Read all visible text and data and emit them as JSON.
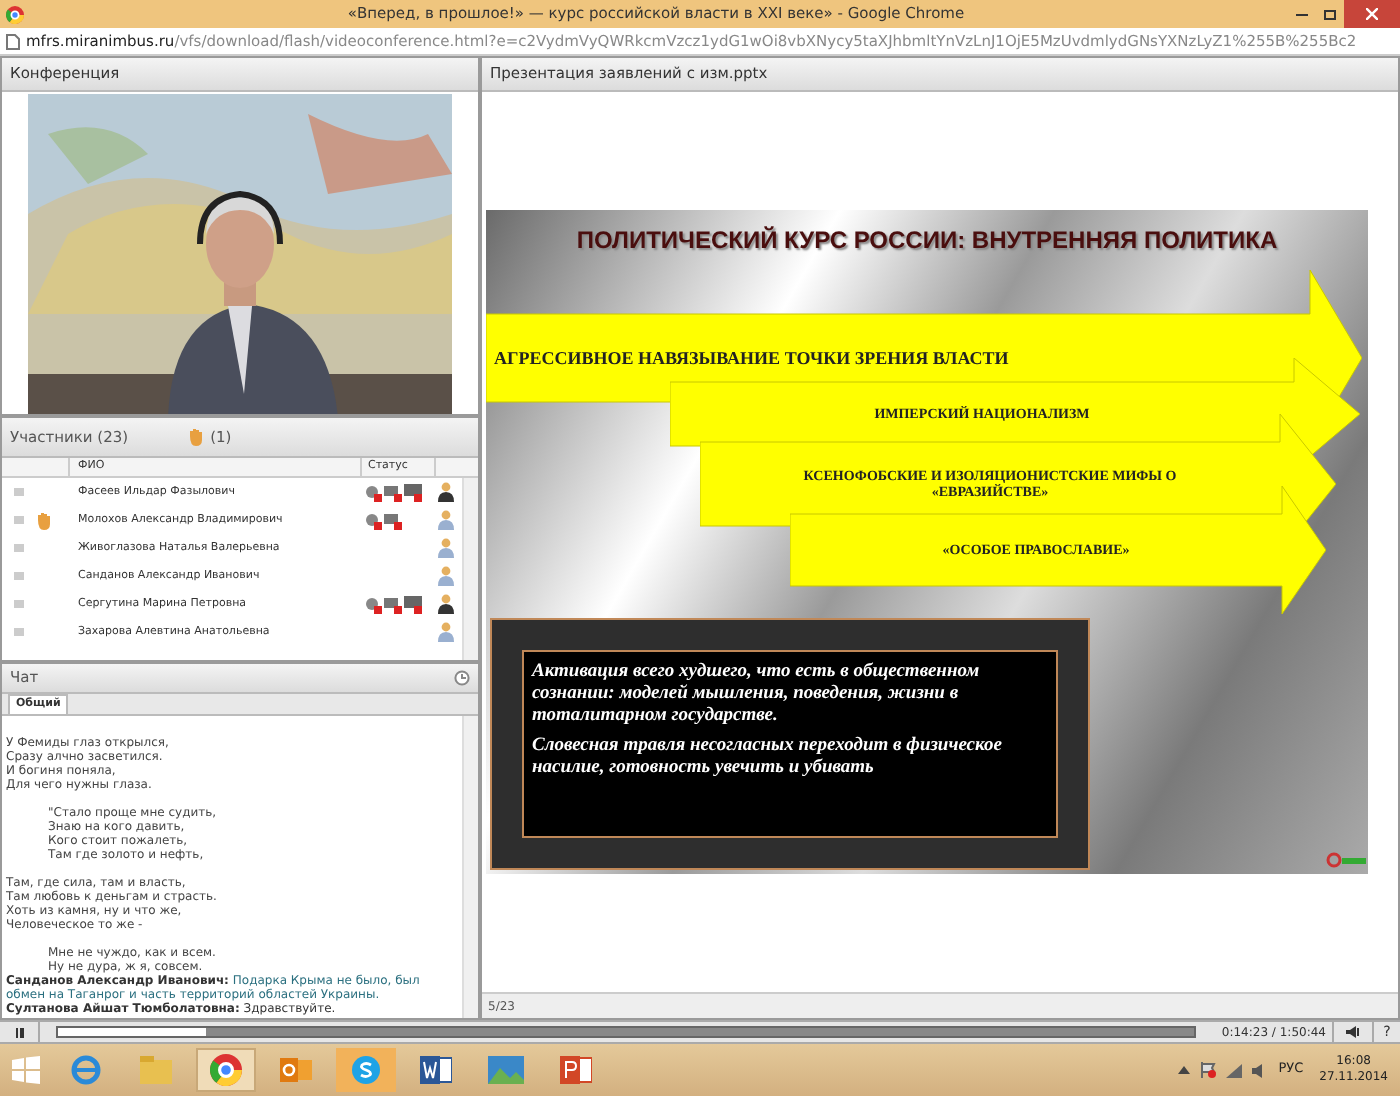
{
  "browser": {
    "title": "«Вперед, в прошлое!» — курс российской власти в XXI веке» - Google Chrome",
    "url_host": "mfrs.miranimbus.ru",
    "url_path": "/vfs/download/flash/videoconference.html?e=c2VydmVyQWRkcmVzcz1ydG1wOi8vbXNycy5taXJhbmltYnVzLnJ1OjE5MzUvdmlydGNsYXNzLyZ1%255B%255Bc2"
  },
  "conference": {
    "title": "Конференция"
  },
  "participants": {
    "title": "Участники (23)",
    "raised_hands": "(1)",
    "columns": [
      "ФИО",
      "Статус"
    ],
    "rows": [
      {
        "name": "Фасеев Ильдар Фазылович",
        "hand_raised": false,
        "mic": true,
        "cam": true,
        "screen": true,
        "active": true
      },
      {
        "name": "Молохов Александр Владимирович",
        "hand_raised": true,
        "mic": true,
        "cam": true,
        "screen": false,
        "active": false
      },
      {
        "name": "Живоглазова Наталья Валерьевна",
        "hand_raised": false,
        "mic": false,
        "cam": false,
        "screen": false,
        "active": false
      },
      {
        "name": "Санданов Александр Иванович",
        "hand_raised": false,
        "mic": false,
        "cam": false,
        "screen": false,
        "active": false
      },
      {
        "name": "Сергутина Марина Петровна",
        "hand_raised": false,
        "mic": true,
        "cam": true,
        "screen": true,
        "active": true
      },
      {
        "name": "Захарова Алевтина Анатольевна",
        "hand_raised": false,
        "mic": false,
        "cam": false,
        "screen": false,
        "active": false
      }
    ]
  },
  "chat": {
    "title": "Чат",
    "tabs": [
      {
        "label": "Общий",
        "selected": true
      }
    ],
    "lines": [
      {
        "kind": "line",
        "text": "У Фемиды глаз открылся,",
        "indent": false
      },
      {
        "kind": "line",
        "text": "Сразу алчно засветился.",
        "indent": false
      },
      {
        "kind": "line",
        "text": "И богиня  поняла,",
        "indent": false
      },
      {
        "kind": "line",
        "text": "Для чего нужны глаза.",
        "indent": false
      },
      {
        "kind": "blank"
      },
      {
        "kind": "line",
        "text": "\"Стало проще мне судить,",
        "indent": true
      },
      {
        "kind": "line",
        "text": "Знаю на  кого  давить,",
        "indent": true
      },
      {
        "kind": "line",
        "text": "Кого стоит пожалеть,",
        "indent": true
      },
      {
        "kind": "line",
        "text": "Там где золото и нефть,",
        "indent": true
      },
      {
        "kind": "blank"
      },
      {
        "kind": "line",
        "text": "Там, где сила, там и власть,",
        "indent": false
      },
      {
        "kind": "line",
        "text": "Там любовь к деньгам и страсть.",
        "indent": false
      },
      {
        "kind": "line",
        "text": "Хоть из камня, ну и что же,",
        "indent": false
      },
      {
        "kind": "line",
        "text": "Человеческое то же -",
        "indent": false
      },
      {
        "kind": "blank"
      },
      {
        "kind": "line",
        "text": "Мне не чуждо, как и всем.",
        "indent": true
      },
      {
        "kind": "line",
        "text": "Ну не дура, ж я,  совсем.",
        "indent": true
      },
      {
        "kind": "message",
        "author": "Санданов Александр Иванович:",
        "text": "Подарка Крыма не было, был обмен на Таганрог и часть территорий областей Украины.",
        "color": "#2a6f7f"
      },
      {
        "kind": "message",
        "author": "Султанова Айшат  Тюмболатовна:",
        "text": "Здравствуйте.",
        "color": "#333333"
      }
    ]
  },
  "presentation": {
    "title": "Презентация заявлений  с изм.pptx",
    "page": "5/23",
    "slide": {
      "title": "ПОЛИТИЧЕСКИЙ КУРС РОССИИ: ВНУТРЕННЯЯ ПОЛИТИКА",
      "arrows": [
        "АГРЕССИВНОЕ НАВЯЗЫВАНИЕ ТОЧКИ ЗРЕНИЯ ВЛАСТИ",
        "ИМПЕРСКИЙ НАЦИОНАЛИЗМ",
        "КСЕНОФОБСКИЕ И ИЗОЛЯЦИОНИСТСКИЕ  МИФЫ О «ЕВРАЗИЙСТВЕ»",
        "«ОСОБОЕ ПРАВОСЛАВИЕ»"
      ],
      "box": [
        "Активация всего худшего, что есть в общественном сознании:  моделей мышления, поведения, жизни в тоталитарном государстве.",
        "Словесная травля несогласных переходит в физическое насилие, готовность увечить и убивать"
      ]
    }
  },
  "player": {
    "level": 0.13,
    "time": "0:14:23 / 1:50:44",
    "help": "?"
  },
  "taskbar": {
    "language": "РУС",
    "time": "16:08",
    "date": "27.11.2014"
  }
}
